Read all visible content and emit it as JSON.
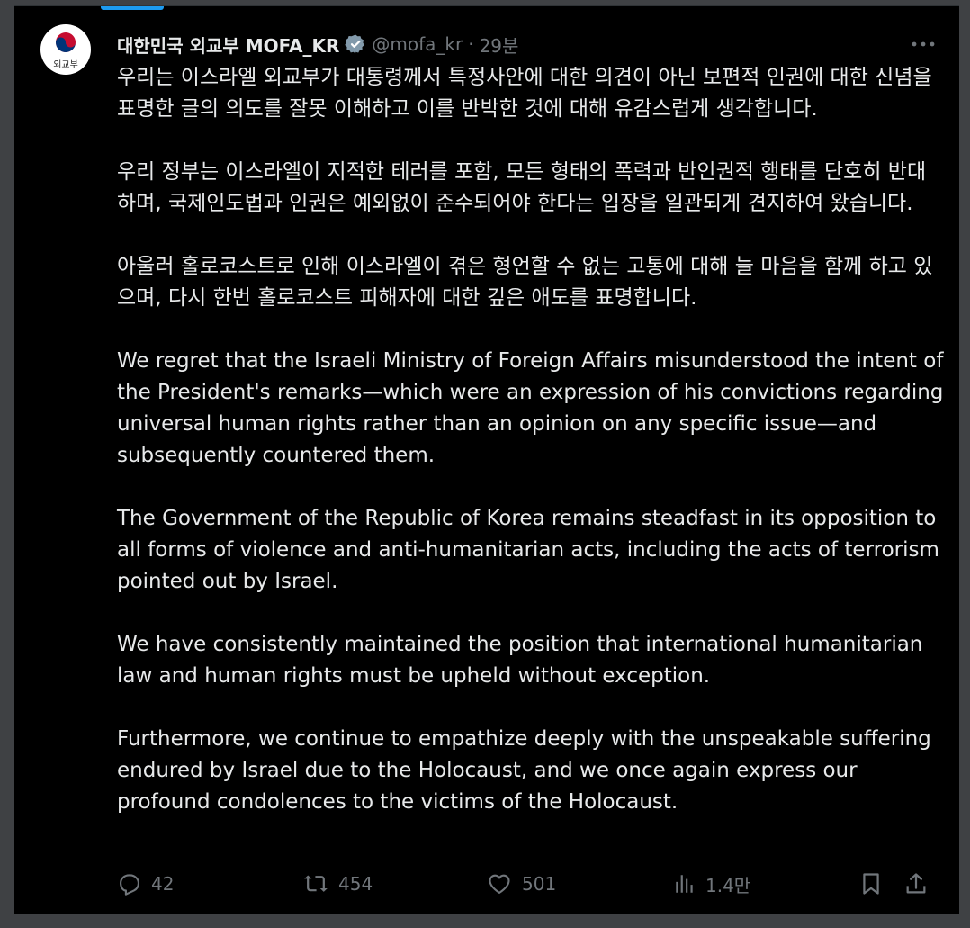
{
  "tweet": {
    "author": {
      "display_name": "대한민국 외교부 MOFA_KR",
      "handle": "@mofa_kr",
      "avatar_text": "외교부",
      "verified": true
    },
    "separator": "·",
    "time": "29분",
    "paragraphs": [
      "우리는 이스라엘 외교부가 대통령께서 특정사안에 대한 의견이 아닌 보편적 인권에 대한 신념을 표명한 글의 의도를 잘못 이해하고 이를 반박한 것에 대해 유감스럽게 생각합니다.",
      "우리 정부는 이스라엘이 지적한 테러를 포함, 모든 형태의 폭력과 반인권적 행태를 단호히 반대하며, 국제인도법과 인권은 예외없이 준수되어야 한다는 입장을 일관되게 견지하여 왔습니다.",
      "아울러 홀로코스트로 인해 이스라엘이 겪은 형언할 수 없는 고통에 대해 늘 마음을 함께 하고 있으며, 다시 한번 홀로코스트 피해자에 대한 깊은 애도를 표명합니다.",
      "We regret that the Israeli Ministry of Foreign Affairs misunderstood the intent of the President's remarks—which were an expression of his convictions regarding universal human rights rather than an opinion on any specific issue—and subsequently countered them.",
      "The Government of the Republic of Korea remains steadfast in its opposition to all forms of violence and anti-humanitarian acts, including the acts of terrorism pointed out by Israel.",
      "We have consistently maintained the position that international humanitarian law and human rights must be upheld without exception.",
      "Furthermore, we continue to empathize deeply with the unspeakable suffering endured by Israel due to the Holocaust, and we once again express our profound condolences to the victims of the Holocaust."
    ],
    "metrics": {
      "replies": "42",
      "reposts": "454",
      "likes": "501",
      "views": "1.4만"
    }
  },
  "colors": {
    "background": "#000000",
    "text": "#e7e9ea",
    "muted": "#71767b",
    "accent": "#1d9bf0"
  },
  "icons": [
    "more-icon",
    "verified-badge-icon",
    "reply-icon",
    "repost-icon",
    "like-icon",
    "views-icon",
    "bookmark-icon",
    "share-icon"
  ]
}
